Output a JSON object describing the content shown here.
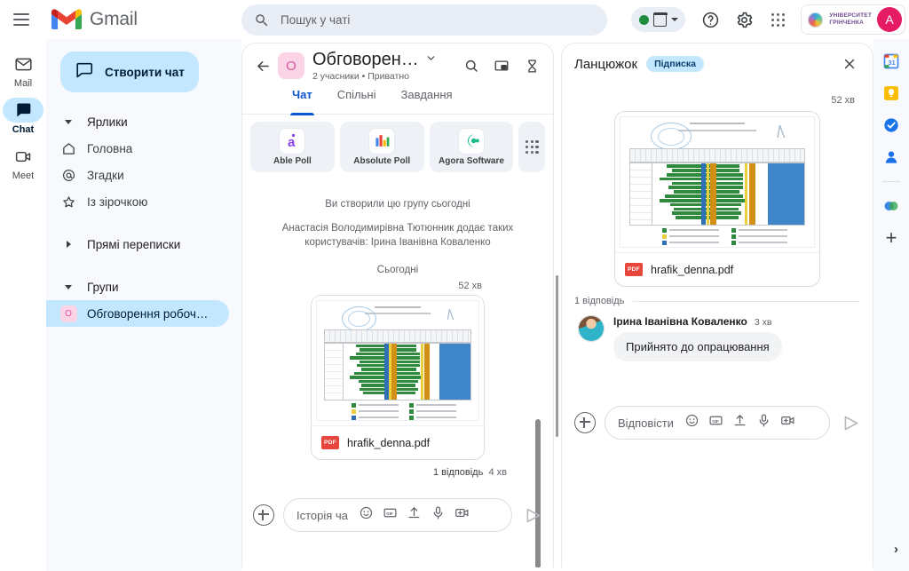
{
  "topbar": {
    "menu_icon": "hamburger-menu-icon",
    "brand": "Gmail",
    "search": {
      "placeholder": "Пошук у чаті",
      "value": "",
      "icon": "search-icon"
    },
    "status": {
      "icon": "green-status-dot",
      "calendar_icon": "calendar-icon",
      "chevron": "chevron-down-icon"
    },
    "help_label": "?",
    "icons": [
      "help-icon",
      "settings-gear-icon",
      "apps-grid-icon"
    ],
    "account": {
      "org_line1": "УНІВЕРСИТЕТ",
      "org_line2": "ГРІНЧЕНКА",
      "avatar_initial": "A",
      "avatar_color": "#e51c63"
    }
  },
  "left_rail": [
    {
      "label": "Mail",
      "icon": "mail-icon",
      "active": false
    },
    {
      "label": "Chat",
      "icon": "chat-icon",
      "active": true
    },
    {
      "label": "Meet",
      "icon": "meet-camera-icon",
      "active": false
    }
  ],
  "sidebar": {
    "create_button": {
      "label": "Створити чат",
      "icon": "chat-bubble-icon"
    },
    "sections": [
      {
        "header": "Ярлики",
        "caret": "caret-down-icon",
        "items": [
          {
            "label": "Головна",
            "icon": "home-icon"
          },
          {
            "label": "Згадки",
            "icon": "at-mention-icon"
          },
          {
            "label": "Із зірочкою",
            "icon": "star-icon"
          }
        ]
      },
      {
        "header": "Прямі переписки",
        "caret": "caret-right-icon",
        "items": []
      },
      {
        "header": "Групи",
        "caret": "caret-down-icon",
        "items": [
          {
            "label": "Обговорення робочи…",
            "icon": "group-avatar",
            "avatar_initial": "О",
            "selected": true
          }
        ]
      }
    ]
  },
  "chat_panel": {
    "back_icon": "back-arrow-icon",
    "avatar_initial": "О",
    "title": "Обговорен…",
    "title_chevron": "chevron-down-icon",
    "subtitle": "2 учасники • Приватно",
    "header_icons": [
      "search-icon",
      "picture-in-picture-icon",
      "hourglass-icon"
    ],
    "tabs": [
      {
        "label": "Чат",
        "active": true
      },
      {
        "label": "Спільні",
        "active": false
      },
      {
        "label": "Завдання",
        "active": false
      }
    ],
    "apps": [
      {
        "name": "Able Poll",
        "icon": "able-poll-icon"
      },
      {
        "name": "Absolute Poll",
        "icon": "absolute-poll-icon"
      },
      {
        "name": "Agora Software",
        "icon": "agora-software-icon"
      }
    ],
    "apps_more_icon": "apps-grid-icon",
    "system_messages": [
      "Ви створили цю групу сьогодні",
      "Анастасія Володимирівна Тютюнник додає таких користувачів: Ірина Іванівна Коваленко"
    ],
    "day_divider": "Сьогодні",
    "message": {
      "time": "52 хв",
      "attachment": {
        "filename": "hrafik_denna.pdf",
        "type_badge": "PDF",
        "badge_color": "#e8453c"
      },
      "reply_summary": "1 відповідь",
      "reply_time": "4 хв"
    },
    "composer": {
      "add_icon": "plus-circle-icon",
      "placeholder": "Історія ча",
      "value": "",
      "icons": [
        "emoji-icon",
        "gif-icon",
        "upload-icon",
        "microphone-icon",
        "video-add-icon"
      ],
      "send_icon": "send-icon"
    }
  },
  "thread_panel": {
    "title": "Ланцюжок",
    "badge": "Підписка",
    "close_icon": "close-icon",
    "message": {
      "time": "52 хв",
      "attachment": {
        "filename": "hrafik_denna.pdf",
        "type_badge": "PDF",
        "badge_color": "#e8453c"
      }
    },
    "replies_label": "1 відповідь",
    "replies": [
      {
        "author": "Ірина Іванівна Коваленко",
        "time": "3 хв",
        "text": "Прийнято до опрацювання",
        "avatar": "user-photo-avatar"
      }
    ],
    "composer": {
      "add_icon": "plus-circle-icon",
      "placeholder": "Відповісти",
      "value": "",
      "icons": [
        "emoji-icon",
        "gif-icon",
        "upload-icon",
        "microphone-icon",
        "video-add-icon"
      ],
      "send_icon": "send-icon"
    }
  },
  "side_rail": {
    "icons": [
      "google-calendar-icon",
      "google-keep-icon",
      "google-tasks-icon",
      "google-contacts-icon",
      "addon-marketplace-icon"
    ],
    "add_label": "+",
    "expand_icon": "chevron-right-icon"
  },
  "colors": {
    "accent_blue": "#0b57d0",
    "selected_blue": "#c2e7ff",
    "sidebar_bg": "#f7f9fc",
    "search_bg": "#e9eef6",
    "pink_avatar": "#fbd4e6",
    "status_green": "#1e8e3e"
  }
}
